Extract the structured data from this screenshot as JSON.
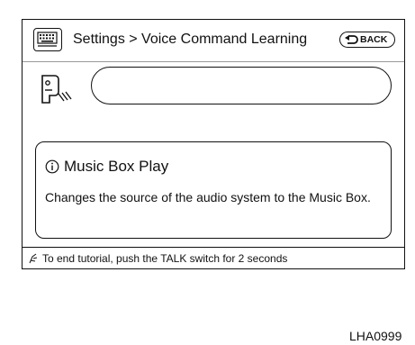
{
  "header": {
    "menu_icon": "menu-icon",
    "breadcrumb": "Settings > Voice Command Learning",
    "back_label": "BACK",
    "back_icon": "back-arrow-icon"
  },
  "voice": {
    "speaker_icon": "speaking-person-icon",
    "recognized_text": ""
  },
  "info": {
    "icon": "info-icon",
    "title": "Music Box Play",
    "description": "Changes the source of the audio system to the Music Box."
  },
  "hint": {
    "icon": "talk-switch-icon",
    "text": "To end tutorial, push the TALK switch for 2 seconds"
  },
  "figure_code": "LHA0999"
}
